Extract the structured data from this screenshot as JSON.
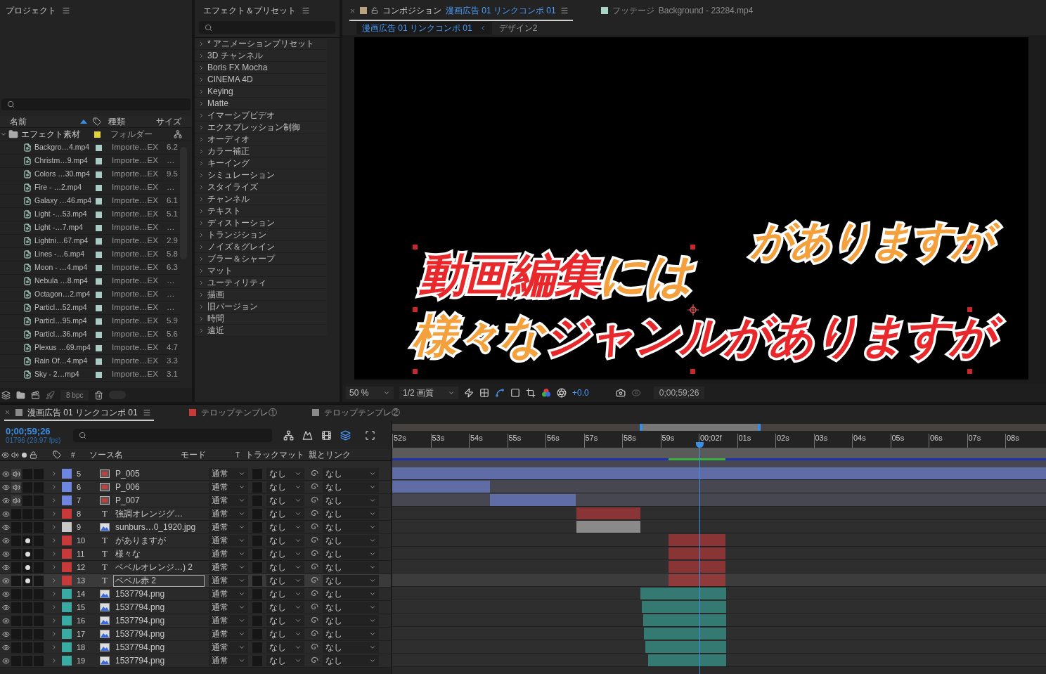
{
  "project": {
    "title": "プロジェクト",
    "columns": [
      {
        "label": "名前"
      },
      {
        "label": "種類"
      },
      {
        "label": "サイズ"
      }
    ],
    "folder": {
      "name": "エフェクト素材",
      "type": "フォルダー",
      "color": "#e3d23c",
      "expanded": true
    },
    "items": [
      {
        "name": "Backgro…4.mp4",
        "type": "Importe…EX",
        "size": "6.2",
        "color": "#a9cbc3"
      },
      {
        "name": "Christm…9.mp4",
        "type": "Importe…EX",
        "size": "…",
        "color": "#a9cbc3"
      },
      {
        "name": "Colors …30.mp4",
        "type": "Importe…EX",
        "size": "9.5",
        "color": "#a9cbc3"
      },
      {
        "name": "Fire - …2.mp4",
        "type": "Importe…EX",
        "size": "…",
        "color": "#a9cbc3"
      },
      {
        "name": "Galaxy …46.mp4",
        "type": "Importe…EX",
        "size": "6.1",
        "color": "#a9cbc3"
      },
      {
        "name": "Light -…53.mp4",
        "type": "Importe…EX",
        "size": "5.1",
        "color": "#a9cbc3"
      },
      {
        "name": "Light -…7.mp4",
        "type": "Importe…EX",
        "size": "…",
        "color": "#a9cbc3"
      },
      {
        "name": "Lightni…67.mp4",
        "type": "Importe…EX",
        "size": "2.9",
        "color": "#a9cbc3"
      },
      {
        "name": "Lines -…6.mp4",
        "type": "Importe…EX",
        "size": "5.8",
        "color": "#a9cbc3"
      },
      {
        "name": "Moon - …4.mp4",
        "type": "Importe…EX",
        "size": "6.3",
        "color": "#a9cbc3"
      },
      {
        "name": "Nebula …8.mp4",
        "type": "Importe…EX",
        "size": "…",
        "color": "#a9cbc3"
      },
      {
        "name": "Octagon…2.mp4",
        "type": "Importe…EX",
        "size": "…",
        "color": "#a9cbc3"
      },
      {
        "name": "Particl…52.mp4",
        "type": "Importe…EX",
        "size": "…",
        "color": "#a9cbc3"
      },
      {
        "name": "Particl…95.mp4",
        "type": "Importe…EX",
        "size": "5.9",
        "color": "#a9cbc3"
      },
      {
        "name": "Particl…36.mp4",
        "type": "Importe…EX",
        "size": "5.6",
        "color": "#a9cbc3"
      },
      {
        "name": "Plexus …69.mp4",
        "type": "Importe…EX",
        "size": "4.7",
        "color": "#a9cbc3"
      },
      {
        "name": "Rain Of…4.mp4",
        "type": "Importe…EX",
        "size": "3.3",
        "color": "#a9cbc3"
      },
      {
        "name": "Sky - 2…mp4",
        "type": "Importe…EX",
        "size": "3.1",
        "color": "#a9cbc3"
      }
    ],
    "bpc": "8 bpc"
  },
  "effects": {
    "title": "エフェクト＆プリセット",
    "items": [
      "* アニメーションプリセット",
      "3D チャンネル",
      "Boris FX Mocha",
      "CINEMA 4D",
      "Keying",
      "Matte",
      "イマーシブビデオ",
      "エクスプレッション制御",
      "オーディオ",
      "カラー補正",
      "キーイング",
      "シミュレーション",
      "スタイライズ",
      "チャンネル",
      "テキスト",
      "ディストーション",
      "トランジション",
      "ノイズ＆グレイン",
      "ブラー＆シャープ",
      "マット",
      "ユーティリティ",
      "描画",
      "旧バージョン",
      "時間",
      "遠近"
    ]
  },
  "composition": {
    "tabs": [
      {
        "label": "コンポジション",
        "name": "漫画広告 01 リンクコンポ 01",
        "color": "#b9a27f",
        "selected": true
      },
      {
        "label": "フッテージ",
        "name": "Background - 23284.mp4",
        "color": "#a9d3c7",
        "selected": false
      }
    ],
    "breadcrumb": [
      {
        "label": "漫画広告 01 リンクコンポ 01",
        "selected": true
      },
      {
        "label": "デザイン2",
        "selected": false
      }
    ],
    "viewer": {
      "selection": true,
      "lines": [
        {
          "runs": [
            {
              "text": "がありますが",
              "color": "#f3a03d"
            }
          ]
        },
        {
          "runs": [
            {
              "text": "動画編集",
              "color": "#e8282b"
            },
            {
              "text": "には",
              "color": "#f3a03d"
            }
          ]
        },
        {
          "runs": [
            {
              "text": "様々な",
              "color": "#f3a03d"
            },
            {
              "text": "ジャンルがありますが",
              "color": "#e8282b"
            }
          ]
        }
      ]
    },
    "toolbar": {
      "zoom": "50 %",
      "resolution": "1/2 画質",
      "exposure": "+0.0",
      "timecode": "0;00;59;26"
    }
  },
  "timeline": {
    "tabs": [
      {
        "label": "漫画広告 01 リンクコンポ 01",
        "color": "#8a8a8a",
        "selected": true
      },
      {
        "label": "テロップテンプレ①",
        "color": "#c83a3a",
        "selected": false
      },
      {
        "label": "テロップテンプレ②",
        "color": "#8a8a8a",
        "selected": false
      }
    ],
    "timecode": "0;00;59;26",
    "frames": "01796 (29.97 fps)",
    "columns": [
      "#",
      "ソース名",
      "モード",
      "T",
      "トラックマット",
      "親とリンク"
    ],
    "ruler": [
      "52s",
      "53s",
      "54s",
      "55s",
      "56s",
      "57s",
      "58s",
      "59s",
      "00;02f",
      "01s",
      "02s",
      "03s",
      "04s",
      "05s",
      "06s",
      "07s",
      "08s"
    ],
    "layers": [
      {
        "num": "5",
        "name": "P_005",
        "kind": "comp",
        "color": "#6f86e0",
        "visible": true,
        "audio": true,
        "solo": false,
        "selected": false,
        "mode": "通常",
        "matte": "なし",
        "parent": "なし"
      },
      {
        "num": "6",
        "name": "P_006",
        "kind": "comp",
        "color": "#6f86e0",
        "visible": true,
        "audio": true,
        "solo": false,
        "selected": false,
        "mode": "通常",
        "matte": "なし",
        "parent": "なし"
      },
      {
        "num": "7",
        "name": "P_007",
        "kind": "comp",
        "color": "#6f86e0",
        "visible": true,
        "audio": true,
        "solo": false,
        "selected": false,
        "mode": "通常",
        "matte": "なし",
        "parent": "なし"
      },
      {
        "num": "8",
        "name": "強調オレンジグ…",
        "kind": "text",
        "glyph": "T",
        "color": "#c83a3a",
        "visible": true,
        "audio": false,
        "solo": false,
        "selected": false,
        "mode": "通常",
        "matte": "なし",
        "parent": "なし"
      },
      {
        "num": "9",
        "name": "sunburs…0_1920.jpg",
        "kind": "image",
        "color": "#c8c8c8",
        "visible": true,
        "audio": false,
        "solo": false,
        "selected": false,
        "mode": "通常",
        "matte": "なし",
        "parent": "なし"
      },
      {
        "num": "10",
        "name": "がありますが",
        "kind": "text",
        "glyph": "T",
        "color": "#c83a3a",
        "visible": true,
        "audio": false,
        "solo": true,
        "selected": false,
        "mode": "通常",
        "matte": "なし",
        "parent": "なし"
      },
      {
        "num": "11",
        "name": "様々な",
        "kind": "text",
        "glyph": "T",
        "color": "#c83a3a",
        "visible": true,
        "audio": false,
        "solo": true,
        "selected": false,
        "mode": "通常",
        "matte": "なし",
        "parent": "なし"
      },
      {
        "num": "12",
        "name": "ベベルオレンジ…) 2",
        "kind": "text",
        "glyph": "T",
        "color": "#c83a3a",
        "visible": true,
        "audio": false,
        "solo": true,
        "selected": false,
        "mode": "通常",
        "matte": "なし",
        "parent": "なし"
      },
      {
        "num": "13",
        "name": "ベベル赤 2",
        "kind": "text",
        "glyph": "T",
        "color": "#c83a3a",
        "visible": true,
        "audio": false,
        "solo": true,
        "selected": true,
        "mode": "通常",
        "matte": "なし",
        "parent": "なし"
      },
      {
        "num": "14",
        "name": "1537794.png",
        "kind": "image",
        "color": "#3aaba2",
        "visible": true,
        "audio": false,
        "solo": false,
        "selected": false,
        "mode": "通常",
        "matte": "なし",
        "parent": "なし"
      },
      {
        "num": "15",
        "name": "1537794.png",
        "kind": "image",
        "color": "#3aaba2",
        "visible": true,
        "audio": false,
        "solo": false,
        "selected": false,
        "mode": "通常",
        "matte": "なし",
        "parent": "なし"
      },
      {
        "num": "16",
        "name": "1537794.png",
        "kind": "image",
        "color": "#3aaba2",
        "visible": true,
        "audio": false,
        "solo": false,
        "selected": false,
        "mode": "通常",
        "matte": "なし",
        "parent": "なし"
      },
      {
        "num": "17",
        "name": "1537794.png",
        "kind": "image",
        "color": "#3aaba2",
        "visible": true,
        "audio": false,
        "solo": false,
        "selected": false,
        "mode": "通常",
        "matte": "なし",
        "parent": "なし"
      },
      {
        "num": "18",
        "name": "1537794.png",
        "kind": "image",
        "color": "#3aaba2",
        "visible": true,
        "audio": false,
        "solo": false,
        "selected": false,
        "mode": "通常",
        "matte": "なし",
        "parent": "なし"
      },
      {
        "num": "19",
        "name": "1537794.png",
        "kind": "image",
        "color": "#3aaba2",
        "visible": true,
        "audio": false,
        "solo": false,
        "selected": false,
        "mode": "通常",
        "matte": "なし",
        "parent": "なし"
      }
    ]
  }
}
